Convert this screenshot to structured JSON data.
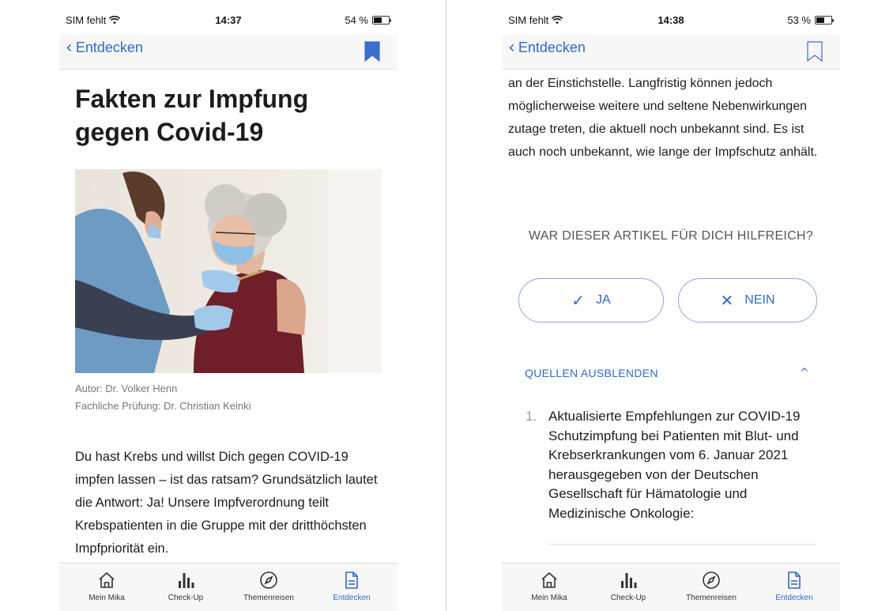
{
  "left": {
    "status": {
      "carrier": "SIM fehlt",
      "time": "14:37",
      "battery": "54 %",
      "battery_level": 0.54
    },
    "nav": {
      "back_label": "Entdecken",
      "bookmark_filled": true
    },
    "article": {
      "title": "Fakten zur Impfung gegen Covid-19",
      "author": "Autor: Dr. Volker Henn",
      "reviewer": "Fachliche Prüfung: Dr. Christian Keinki",
      "intro": "Du hast Krebs und willst Dich gegen COVID-19 impfen lassen – ist das ratsam? Grundsätzlich lautet die Antwort: Ja! Unsere Impfverordnung teilt Krebspatienten in die Gruppe mit der dritthöchsten Impfpriorität ein."
    }
  },
  "right": {
    "status": {
      "carrier": "SIM fehlt",
      "time": "14:38",
      "battery": "53 %",
      "battery_level": 0.53
    },
    "nav": {
      "back_label": "Entdecken",
      "bookmark_filled": false
    },
    "body": "an der Einstichstelle. Langfristig können jedoch möglicherweise weitere und seltene Nebenwirkungen zutage treten, die aktuell noch unbekannt sind. Es ist auch noch unbekannt, wie lange der Impfschutz anhält.",
    "feedback": {
      "question": "WAR DIESER ARTIKEL FÜR DICH HILFREICH?",
      "yes": "JA",
      "no": "NEIN"
    },
    "sources": {
      "toggle_label": "QUELLEN AUSBLENDEN",
      "items": [
        {
          "num": "1.",
          "text": "Aktualisierte Empfehlungen zur COVID-19 Schutzimpfung bei Patienten mit Blut- und Krebserkrankungen vom 6. Januar 2021 herausgegeben von der Deutschen Gesellschaft für Hämatologie und Medizinische Onkologie:"
        }
      ]
    }
  },
  "tabs": [
    {
      "label": "Mein Mika",
      "icon": "home-icon",
      "active": false
    },
    {
      "label": "Check-Up",
      "icon": "bar-chart-icon",
      "active": false
    },
    {
      "label": "Themenreisen",
      "icon": "compass-icon",
      "active": false
    },
    {
      "label": "Entdecken",
      "icon": "document-icon",
      "active": true
    }
  ],
  "colors": {
    "accent": "#2f6ac9",
    "text": "#1c1c1e",
    "muted": "#777777"
  }
}
